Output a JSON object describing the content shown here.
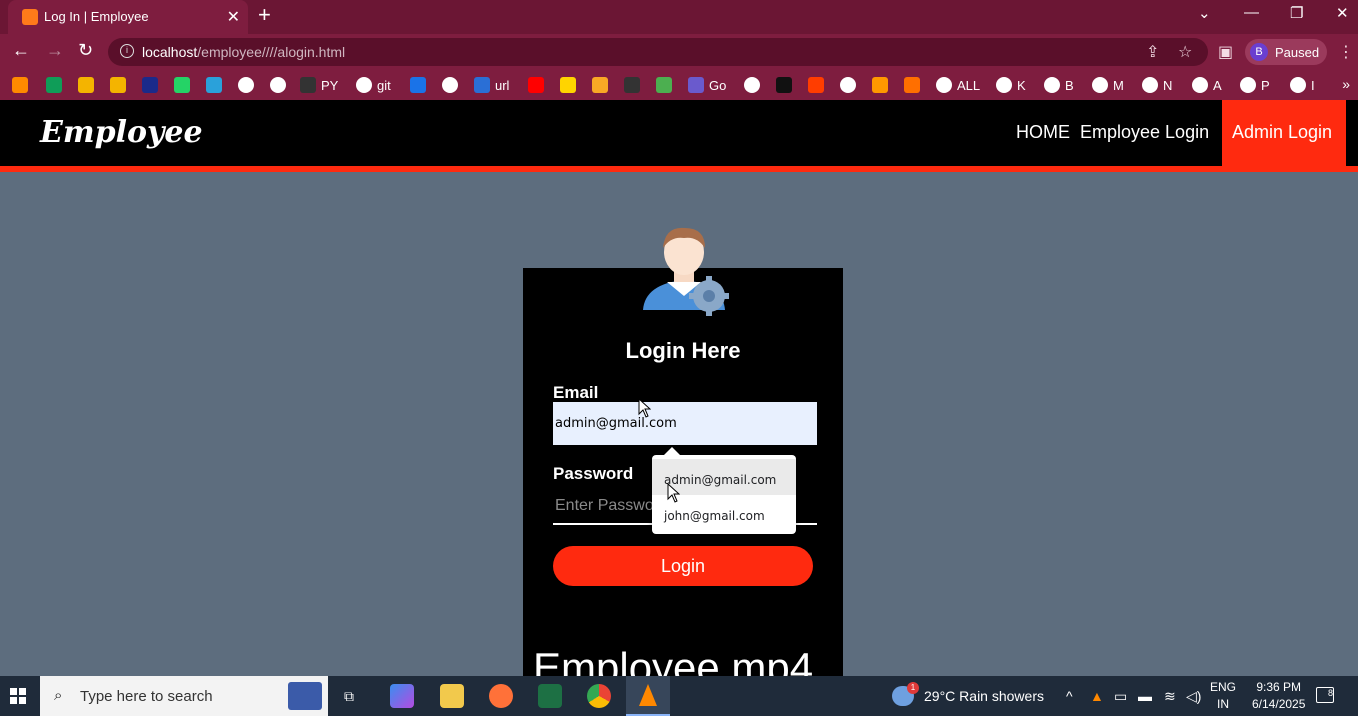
{
  "browser": {
    "tab_title": "Log In | Employee",
    "tab_close": "✕",
    "new_tab": "+",
    "url_host": "localhost",
    "url_path": "/employee////alogin.html",
    "profile_initial": "B",
    "profile_status": "Paused",
    "bookmarks": [
      {
        "label": "",
        "color": "#ff8a00"
      },
      {
        "label": "",
        "color": "#0f9d58"
      },
      {
        "label": "",
        "color": "#f4b400"
      },
      {
        "label": "",
        "color": "#f4b400"
      },
      {
        "label": "",
        "color": "#1a2a8a"
      },
      {
        "label": "",
        "color": "#25d366"
      },
      {
        "label": "",
        "color": "#2aa1da"
      },
      {
        "label": "",
        "color": "#ffffff"
      },
      {
        "label": "",
        "color": "#ffffff"
      },
      {
        "label": "PY",
        "color": "#333333"
      },
      {
        "label": "git",
        "color": "#ffffff"
      },
      {
        "label": "",
        "color": "#1a73e8"
      },
      {
        "label": "",
        "color": "#ffffff"
      },
      {
        "label": "url",
        "color": "#2a6fd6"
      },
      {
        "label": "",
        "color": "#ff0000"
      },
      {
        "label": "",
        "color": "#ffd400"
      },
      {
        "label": "",
        "color": "#f9a825"
      },
      {
        "label": "",
        "color": "#333333"
      },
      {
        "label": "",
        "color": "#4caf50"
      },
      {
        "label": "Go",
        "color": "#6a5acd"
      },
      {
        "label": "",
        "color": "#ffffff"
      },
      {
        "label": "",
        "color": "#111111"
      },
      {
        "label": "",
        "color": "#ff3d00"
      },
      {
        "label": "",
        "color": "#ffffff"
      },
      {
        "label": "",
        "color": "#ff9800"
      },
      {
        "label": "",
        "color": "#ff6f00"
      },
      {
        "label": "ALL",
        "color": "#ffffff"
      },
      {
        "label": "K",
        "color": "#ffffff"
      },
      {
        "label": "B",
        "color": "#ffffff"
      },
      {
        "label": "M",
        "color": "#ffffff"
      },
      {
        "label": "N",
        "color": "#ffffff"
      },
      {
        "label": "A",
        "color": "#ffffff"
      },
      {
        "label": "P",
        "color": "#ffffff"
      },
      {
        "label": "I",
        "color": "#ffffff"
      }
    ],
    "bookmarks_more": "»"
  },
  "site": {
    "logo": "Employee",
    "nav": {
      "home": "HOME",
      "employee_login": "Employee Login",
      "admin_login": "Admin Login"
    }
  },
  "login": {
    "title": "Login Here",
    "email_label": "Email",
    "email_value": "admin@gmail.com",
    "password_label": "Password",
    "password_placeholder": "Enter Password",
    "button": "Login",
    "video_text": "Employee.mp4"
  },
  "autofill": {
    "options": [
      "admin@gmail.com",
      "john@gmail.com"
    ]
  },
  "taskbar": {
    "search_placeholder": "Type here to search",
    "weather": "29°C  Rain showers",
    "weather_badge": "1",
    "lang_line1": "ENG",
    "lang_line2": "IN",
    "time": "9:36 PM",
    "date": "6/14/2025",
    "notif_count": "8"
  },
  "colors": {
    "accent": "#ff2a0f",
    "page_bg": "#5d6d7e",
    "chrome": "#7e1d3f"
  }
}
